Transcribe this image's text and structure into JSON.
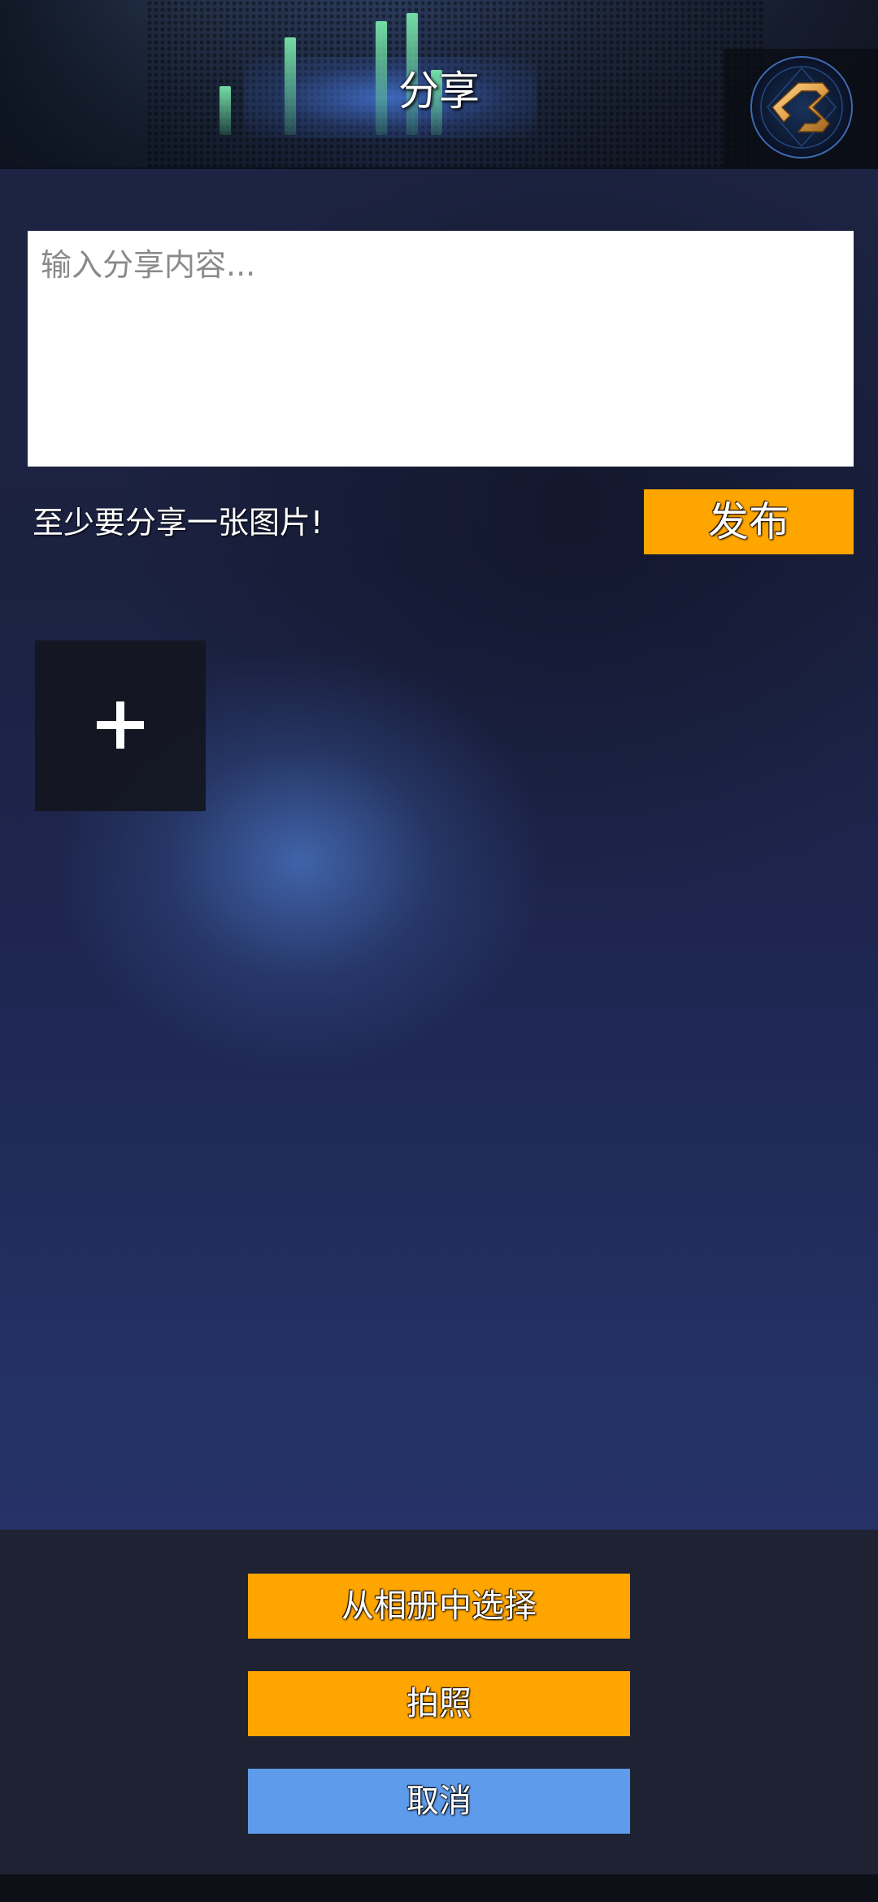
{
  "header": {
    "title": "分享",
    "home_icon": "home-return-icon"
  },
  "share": {
    "placeholder": "输入分享内容...",
    "value": ""
  },
  "hint": {
    "text": "至少要分享一张图片!"
  },
  "publish": {
    "label": "发布"
  },
  "add_image": {
    "icon": "plus-icon"
  },
  "action_sheet": {
    "album_label": "从相册中选择",
    "photo_label": "拍照",
    "cancel_label": "取消"
  },
  "colors": {
    "accent": "#fea500",
    "cancel": "#5e9bea",
    "sheet_background": "#1e2233"
  }
}
